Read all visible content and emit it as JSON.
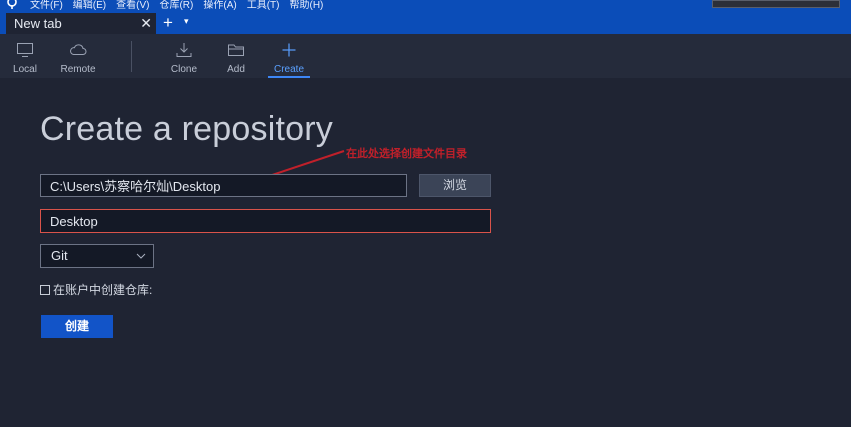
{
  "menubar": {
    "items": [
      "文件(F)",
      "编辑(E)",
      "查看(V)",
      "仓库(R)",
      "操作(A)",
      "工具(T)",
      "帮助(H)"
    ]
  },
  "tabs": {
    "active_label": "New tab",
    "close_glyph": "✕",
    "add_glyph": "+",
    "menu_glyph": "▾"
  },
  "toolbar": {
    "local_label": "Local",
    "remote_label": "Remote",
    "clone_label": "Clone",
    "add_label": "Add",
    "create_label": "Create",
    "active": "Create"
  },
  "form": {
    "title": "Create a repository",
    "annotation": "在此处选择创建文件目录",
    "path_value": "C:\\Users\\苏察哈尔灿\\Desktop",
    "browse_label": "浏览",
    "name_value": "Desktop",
    "vcs_value": "Git",
    "account_checkbox_label": "在账户中创建仓库:",
    "account_checkbox_checked": false,
    "create_label": "创建"
  },
  "colors": {
    "accent": "#1254c8",
    "menubar": "#0b4db8",
    "background": "#1f2433",
    "annotation": "#c0202a",
    "name_border": "#d9534a"
  }
}
